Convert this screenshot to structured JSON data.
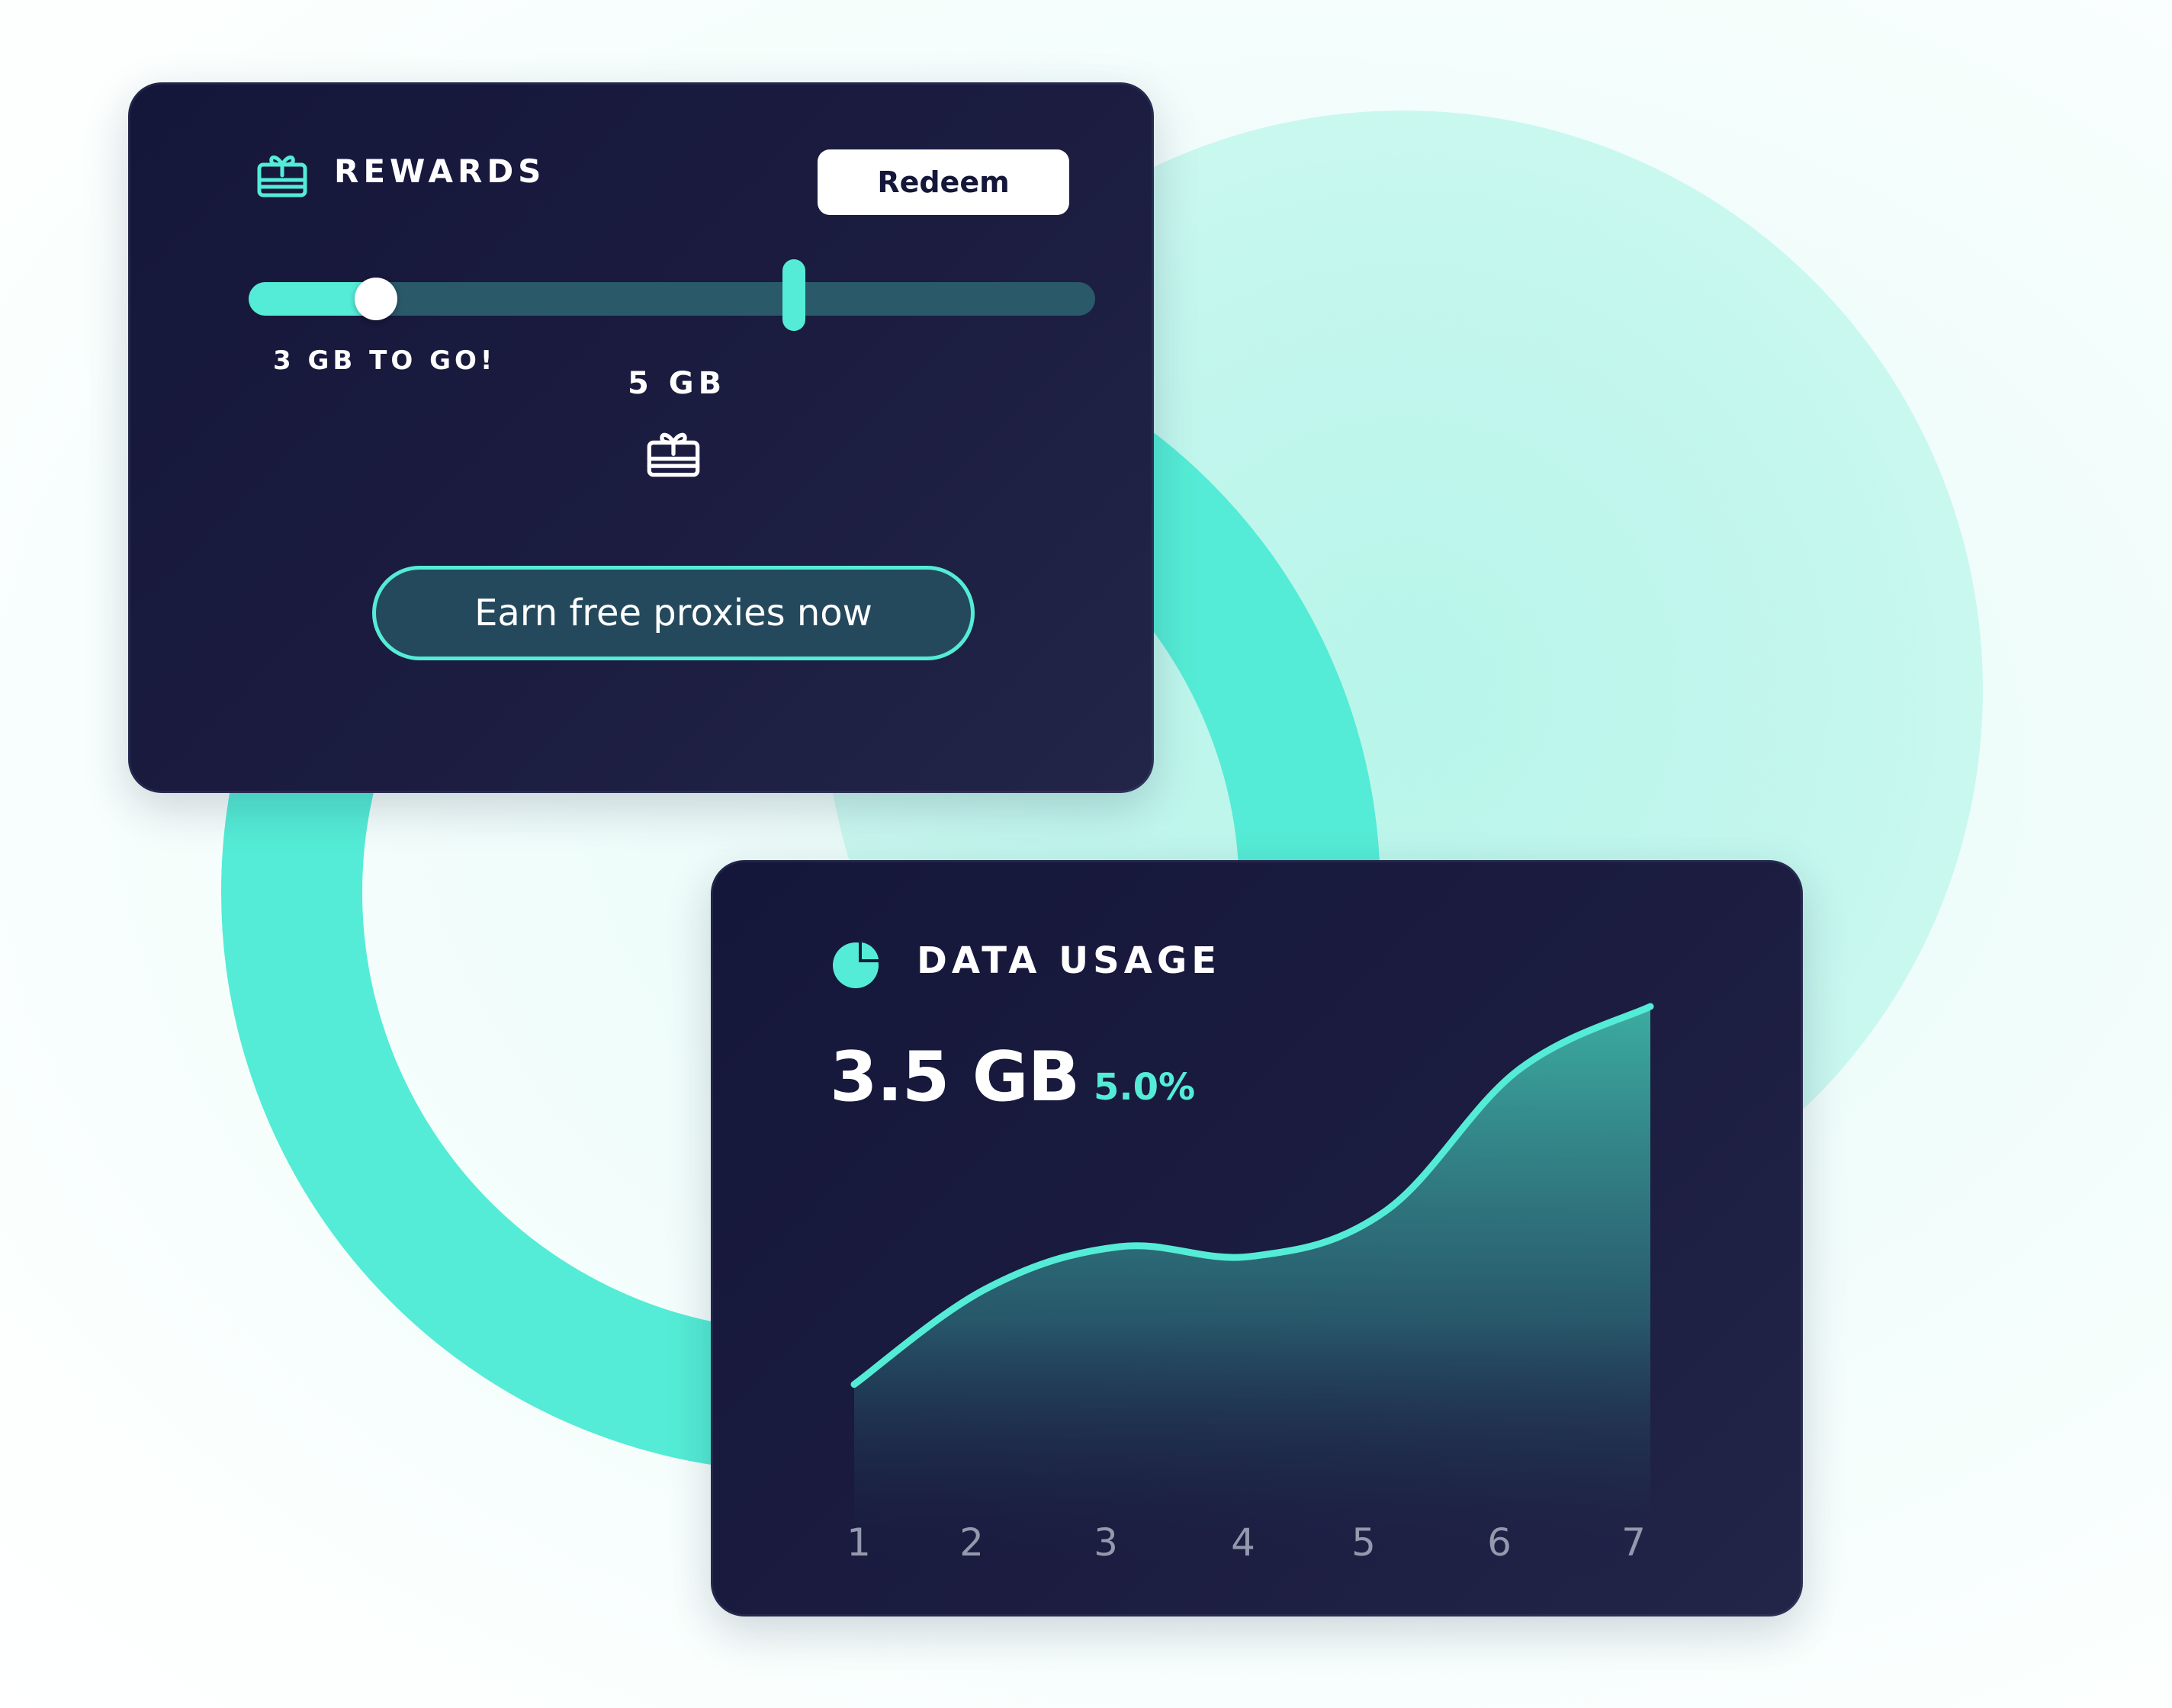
{
  "rewards": {
    "title": "REWARDS",
    "icon": "gift-icon",
    "redeem_label": "Redeem",
    "progress_label": "3 GB TO GO!",
    "milestone_label": "5 GB",
    "milestone_icon": "gift-icon",
    "earn_label": "Earn free proxies now",
    "progress_fraction": 0.15,
    "milestone_fraction": 0.5
  },
  "data_usage": {
    "title": "DATA USAGE",
    "icon": "pie-chart-icon",
    "value": "3.5 GB",
    "change": "5.0%"
  },
  "colors": {
    "accent": "#54ecd6",
    "card_bg": "#1a1b3f",
    "track": "#2a5a6a",
    "text": "#ffffff",
    "tick_text": "#9599ad"
  },
  "chart_data": {
    "type": "area",
    "x": [
      1,
      2,
      3,
      4,
      5,
      6,
      7
    ],
    "xticks": [
      "1",
      "2",
      "3",
      "4",
      "5",
      "6",
      "7"
    ],
    "values": [
      22,
      52,
      65,
      62,
      76,
      120,
      140
    ],
    "ylim": [
      0,
      150
    ],
    "grid": false,
    "legend": "none"
  }
}
